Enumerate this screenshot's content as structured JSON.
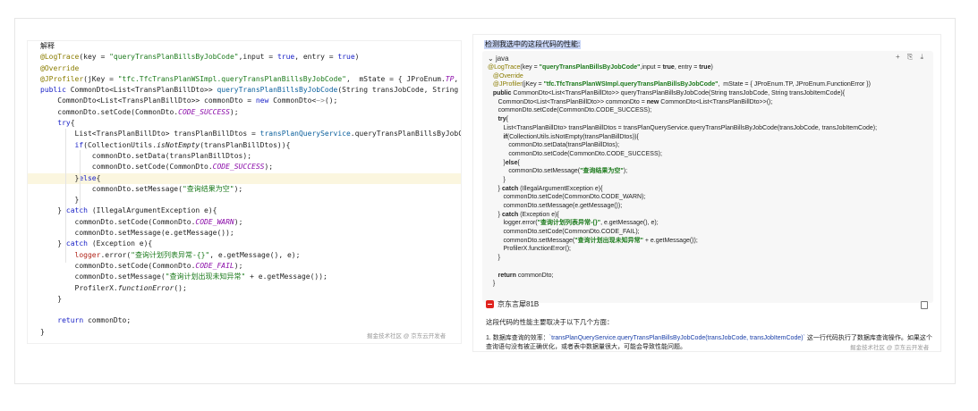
{
  "left": {
    "watermark": "掘金技术社区 @ 京东云开发者",
    "lines": [
      [
        [
          "",
          "解释"
        ]
      ],
      [
        [
          "an",
          "@LogTrace"
        ],
        [
          "",
          "(key = "
        ],
        [
          "str",
          "\"queryTransPlanBillsByJobCode\""
        ],
        [
          "",
          ",input = "
        ],
        [
          "kw",
          "true"
        ],
        [
          "",
          ", entry = "
        ],
        [
          "kw",
          "true"
        ],
        [
          "",
          ")"
        ]
      ],
      [
        [
          "an",
          "@Override"
        ]
      ],
      [
        [
          "an",
          "@JProfiler"
        ],
        [
          "",
          "(jKey = "
        ],
        [
          "str",
          "\"tfc.TfcTransPlanWSImpl.queryTransPlanBillsByJobCode\""
        ],
        [
          "",
          ",  mState = { JProEnum."
        ],
        [
          "cst",
          "TP"
        ],
        [
          "",
          ", JProEnum."
        ]
      ],
      [
        [
          "kw",
          "public "
        ],
        [
          "",
          "CommonDto<List<TransPlanBillDto>> "
        ],
        [
          "mth",
          "queryTransPlanBillsByJobCode"
        ],
        [
          "",
          "(String transJobCode, String transJobI"
        ]
      ],
      [
        [
          "",
          "    CommonDto<List<TransPlanBillDto>> commonDto = "
        ],
        [
          "kw",
          "new "
        ],
        [
          "",
          "CommonDto<"
        ],
        [
          "gray",
          "~>"
        ],
        [
          "",
          "();"
        ]
      ],
      [
        [
          "",
          "    commonDto.setCode(CommonDto."
        ],
        [
          "cst",
          "CODE_SUCCESS"
        ],
        [
          "",
          ");"
        ]
      ],
      [
        [
          "",
          "    "
        ],
        [
          "kw",
          "try"
        ],
        [
          "",
          "{"
        ]
      ],
      [
        [
          "",
          "        List<TransPlanBillDto> transPlanBillDtos = "
        ],
        [
          "mth",
          "transPlanQueryService"
        ],
        [
          "",
          ".queryTransPlanBillsByJobCode(trans"
        ]
      ],
      [
        [
          "",
          "        "
        ],
        [
          "kw",
          "if"
        ],
        [
          "",
          "(CollectionUtils."
        ],
        [
          "it",
          "isNotEmpty"
        ],
        [
          "",
          "(transPlanBillDtos)){"
        ]
      ],
      [
        [
          "",
          "            commonDto.setData(transPlanBillDtos);"
        ]
      ],
      [
        [
          "",
          "            commonDto.setCode(CommonDto."
        ],
        [
          "cst",
          "CODE_SUCCESS"
        ],
        [
          "",
          ");"
        ]
      ],
      [
        [
          "",
          "        }"
        ],
        [
          "kw",
          "else"
        ],
        [
          "",
          "{"
        ]
      ],
      [
        [
          "",
          "            commonDto.setMessage("
        ],
        [
          "str",
          "\"查询结果为空\""
        ],
        [
          "",
          ");"
        ]
      ],
      [
        [
          "",
          "        }"
        ]
      ],
      [
        [
          "",
          "    } "
        ],
        [
          "kw",
          "catch "
        ],
        [
          "",
          "(IllegalArgumentException e){"
        ]
      ],
      [
        [
          "",
          "        commonDto.setCode(CommonDto."
        ],
        [
          "cst",
          "CODE_WARN"
        ],
        [
          "",
          ");"
        ]
      ],
      [
        [
          "",
          "        commonDto.setMessage(e.getMessage());"
        ]
      ],
      [
        [
          "",
          "    } "
        ],
        [
          "kw",
          "catch "
        ],
        [
          "",
          "(Exception e){"
        ]
      ],
      [
        [
          "",
          "        "
        ],
        [
          "red",
          "logger"
        ],
        [
          "",
          ".error("
        ],
        [
          "str",
          "\"查询计划列表异常-{}\""
        ],
        [
          "",
          ", e.getMessage(), e);"
        ]
      ],
      [
        [
          "",
          "        commonDto.setCode(CommonDto."
        ],
        [
          "cst",
          "CODE_FAIL"
        ],
        [
          "",
          ");"
        ]
      ],
      [
        [
          "",
          "        commonDto.setMessage("
        ],
        [
          "str",
          "\"查询计划出现未知异常\""
        ],
        [
          "",
          " + e.getMessage());"
        ]
      ],
      [
        [
          "",
          "        ProfilerX."
        ],
        [
          "it",
          "functionError"
        ],
        [
          "",
          "();"
        ]
      ],
      [
        [
          "",
          "    }"
        ]
      ],
      [
        [
          "",
          ""
        ]
      ],
      [
        [
          "",
          "    "
        ],
        [
          "kw",
          "return "
        ],
        [
          "",
          "commonDto;"
        ]
      ],
      [
        [
          "",
          "}"
        ]
      ]
    ]
  },
  "right": {
    "selected_title": "检测我选中的这段代码的性能:",
    "code_lang": "java",
    "toolbar_glyphs": "+ ⎘ ⤓",
    "watermark": "掘金技术社区 @ 京东云开发者",
    "ai_name": "京东言犀81B",
    "answer_intro": "这段代码的性能主要取决于以下几个方面：",
    "answer_point_prefix": "1. 数据库查询的效率：",
    "answer_point_code": "`transPlanQueryService.queryTransPlanBillsByJobCode(transJobCode, transJobItemCode)`",
    "answer_point_rest": " 这一行代码执行了数据库查询操作。如果这个查询语句没有被正确优化，或者表中数据量很大，可能会导致性能问题。",
    "lines": [
      [
        [
          "ra",
          "@LogTrace"
        ],
        [
          "",
          "(key = "
        ],
        [
          "rs",
          "\"queryTransPlanBillsByJobCode\""
        ],
        [
          "",
          ",input = "
        ],
        [
          "b",
          "true"
        ],
        [
          "",
          ", entry = "
        ],
        [
          "b",
          "true"
        ],
        [
          "",
          ")"
        ]
      ],
      [
        [
          "ra",
          "   @Override"
        ]
      ],
      [
        [
          "ra",
          "   @JProfiler"
        ],
        [
          "",
          "(jKey = "
        ],
        [
          "rs",
          "\"tfc.TfcTransPlanWSImpl.queryTransPlanBillsByJobCode\""
        ],
        [
          "",
          ",  mState = { JProEnum.TP, JProEnum.FunctionError })"
        ]
      ],
      [
        [
          "b",
          "   public "
        ],
        [
          "",
          "CommonDto<List<TransPlanBillDto>> queryTransPlanBillsByJobCode(String transJobCode, String transJobItemCode){"
        ]
      ],
      [
        [
          "",
          "      CommonDto<List<TransPlanBillDto>> commonDto = "
        ],
        [
          "b",
          "new "
        ],
        [
          "",
          "CommonDto<List<TransPlanBillDto>>();"
        ]
      ],
      [
        [
          "",
          "      commonDto.setCode(CommonDto.CODE_SUCCESS);"
        ]
      ],
      [
        [
          "b",
          "      try"
        ],
        [
          "",
          "{"
        ]
      ],
      [
        [
          "",
          "         List<TransPlanBillDto> transPlanBillDtos = transPlanQueryService.queryTransPlanBillsByJobCode(transJobCode, transJobItemCode);"
        ]
      ],
      [
        [
          "b",
          "         if"
        ],
        [
          "",
          "(CollectionUtils.isNotEmpty(transPlanBillDtos)){"
        ]
      ],
      [
        [
          "",
          "            commonDto.setData(transPlanBillDtos);"
        ]
      ],
      [
        [
          "",
          "            commonDto.setCode(CommonDto.CODE_SUCCESS);"
        ]
      ],
      [
        [
          "",
          "         }"
        ],
        [
          "b",
          "else"
        ],
        [
          "",
          "{"
        ]
      ],
      [
        [
          "",
          "            commonDto.setMessage("
        ],
        [
          "rs",
          "\"查询结果为空\""
        ],
        [
          "",
          ");"
        ]
      ],
      [
        [
          "",
          "         }"
        ]
      ],
      [
        [
          "",
          "      } "
        ],
        [
          "b",
          "catch "
        ],
        [
          "",
          "(IllegalArgumentException e){"
        ]
      ],
      [
        [
          "",
          "         commonDto.setCode(CommonDto.CODE_WARN);"
        ]
      ],
      [
        [
          "",
          "         commonDto.setMessage(e.getMessage());"
        ]
      ],
      [
        [
          "",
          "      } "
        ],
        [
          "b",
          "catch "
        ],
        [
          "",
          "(Exception e){"
        ]
      ],
      [
        [
          "",
          "         logger.error("
        ],
        [
          "rs",
          "\"查询计划列表异常-{}\""
        ],
        [
          "",
          ", e.getMessage(), e);"
        ]
      ],
      [
        [
          "",
          "         commonDto.setCode(CommonDto.CODE_FAIL);"
        ]
      ],
      [
        [
          "",
          "         commonDto.setMessage("
        ],
        [
          "rs",
          "\"查询计划出现未知异常\""
        ],
        [
          "",
          " + e.getMessage());"
        ]
      ],
      [
        [
          "",
          "         ProfilerX.functionError();"
        ]
      ],
      [
        [
          "",
          "      }"
        ]
      ],
      [
        [
          "",
          ""
        ]
      ],
      [
        [
          "b",
          "      return "
        ],
        [
          "",
          "commonDto;"
        ]
      ],
      [
        [
          "",
          "   }"
        ]
      ]
    ]
  }
}
